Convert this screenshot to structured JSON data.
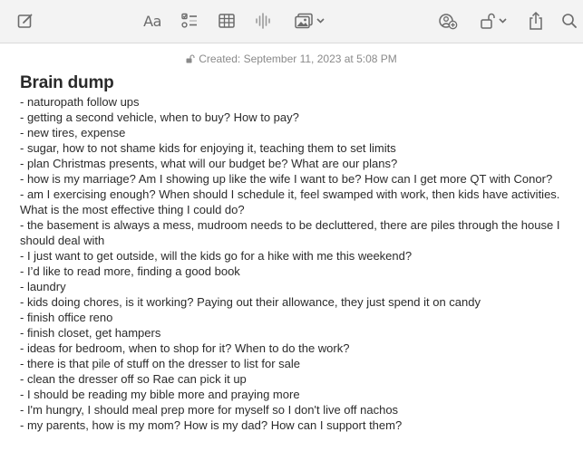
{
  "toolbar": {
    "compose_icon": "compose-icon",
    "format_label": "Aa",
    "checklist_icon": "checklist-icon",
    "table_icon": "table-icon",
    "audio_icon": "audio-waveform-icon",
    "media_icon": "photo-media-icon",
    "collaborate_icon": "collaborate-icon",
    "lock_icon": "lock-icon",
    "share_icon": "share-icon",
    "search_icon": "search-icon"
  },
  "note": {
    "created": "Created: September 11, 2023 at 5:08 PM",
    "title": "Brain dump",
    "lines": [
      "- naturopath follow ups",
      "- getting a second vehicle, when to buy? How to pay?",
      "- new tires, expense",
      "- sugar, how to not shame kids for enjoying it, teaching them to set limits",
      "- plan Christmas presents, what will our budget be? What are our plans?",
      "- how is my marriage? Am I showing up like the wife I want to be? How can I get more QT with Conor?",
      "- am I exercising enough? When should I schedule it, feel swamped with work, then kids have activities. What is the most effective thing I could do?",
      "- the basement is always a mess, mudroom needs to be decluttered, there are piles through the house I should deal with",
      "- I just want to get outside, will the kids go for a hike with me this weekend?",
      "- I’d like to read more, finding a good book",
      "- laundry",
      "- kids doing chores, is it working? Paying out their allowance, they just spend it on candy",
      "- finish office reno",
      "- finish closet, get hampers",
      "- ideas for bedroom, when to shop for it? When to do the work?",
      "- there is that pile of stuff on the dresser to list for sale",
      "- clean the dresser off so Rae can pick it up",
      "- I should be reading my bible more and praying more",
      "- I'm hungry, I should meal prep more for myself so I don't live off nachos",
      "- my parents, how is my mom? How is my dad? How can I support them?"
    ]
  }
}
